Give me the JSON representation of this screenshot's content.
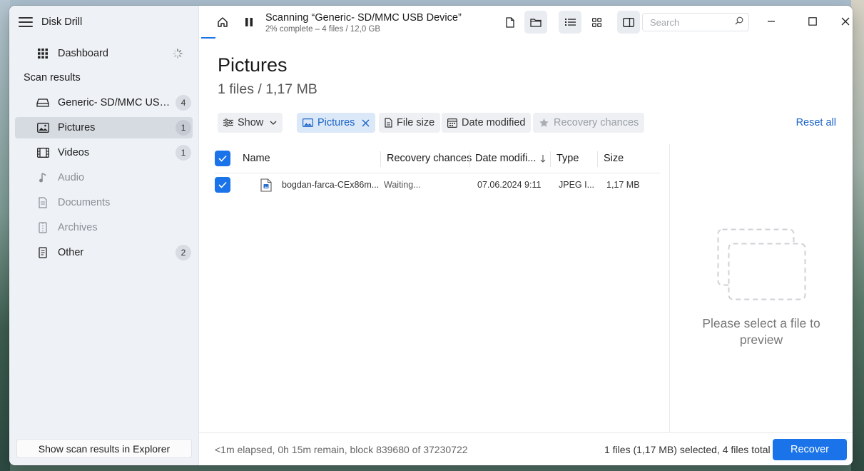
{
  "app": {
    "title": "Disk Drill"
  },
  "sidebar": {
    "dashboard_label": "Dashboard",
    "section_label": "Scan results",
    "items": [
      {
        "label": "Generic- SD/MMC USB D...",
        "count": "4",
        "icon": "drive-icon"
      },
      {
        "label": "Pictures",
        "count": "1",
        "icon": "image-icon"
      },
      {
        "label": "Videos",
        "count": "1",
        "icon": "film-icon"
      },
      {
        "label": "Audio",
        "count": "",
        "icon": "music-icon"
      },
      {
        "label": "Documents",
        "count": "",
        "icon": "document-icon"
      },
      {
        "label": "Archives",
        "count": "",
        "icon": "archive-icon"
      },
      {
        "label": "Other",
        "count": "2",
        "icon": "file-icon"
      }
    ],
    "explorer_button": "Show scan results in Explorer"
  },
  "toolbar": {
    "scan_title": "Scanning “Generic- SD/MMC USB Device”",
    "scan_subtitle": "2% complete – 4 files / 12,0 GB",
    "search_placeholder": "Search"
  },
  "main": {
    "title": "Pictures",
    "subtitle": "1 files / 1,17 MB",
    "filters": {
      "show": "Show",
      "pictures": "Pictures",
      "file_size": "File size",
      "date_modified": "Date modified",
      "recovery_chances": "Recovery chances"
    },
    "reset_all": "Reset all"
  },
  "table": {
    "columns": {
      "name": "Name",
      "recovery": "Recovery chances",
      "date": "Date modifi...",
      "type": "Type",
      "size": "Size"
    },
    "rows": [
      {
        "name": "bogdan-farca-CEx86m...",
        "recovery": "Waiting...",
        "date": "07.06.2024 9:11",
        "type": "JPEG I...",
        "size": "1,17 MB"
      }
    ]
  },
  "preview": {
    "message_line1": "Please select a file to",
    "message_line2": "preview"
  },
  "status": {
    "left": "<1m elapsed, 0h 15m remain, block 839680 of 37230722",
    "right": "1 files (1,17 MB) selected, 4 files total",
    "recover_button": "Recover"
  },
  "colors": {
    "accent": "#1a73e8",
    "link": "#1a63c8",
    "sidebar_bg": "#eef1f5"
  }
}
